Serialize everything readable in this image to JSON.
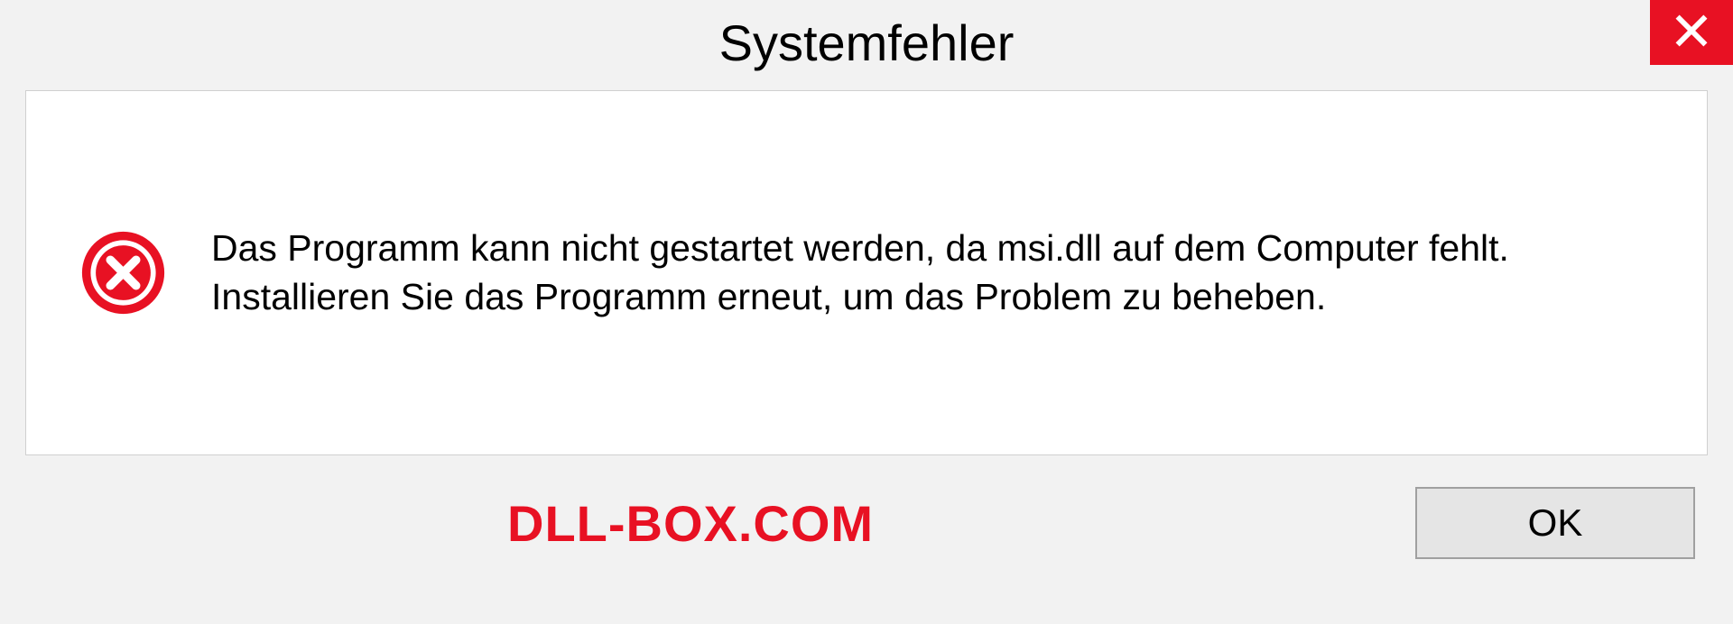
{
  "dialog": {
    "title": "Systemfehler",
    "message": "Das Programm kann nicht gestartet werden, da msi.dll auf dem Computer fehlt. Installieren Sie das Programm erneut, um das Problem zu beheben.",
    "ok_label": "OK"
  },
  "watermark": "DLL-BOX.COM",
  "colors": {
    "close_red": "#e81123",
    "watermark_red": "#e81123"
  }
}
